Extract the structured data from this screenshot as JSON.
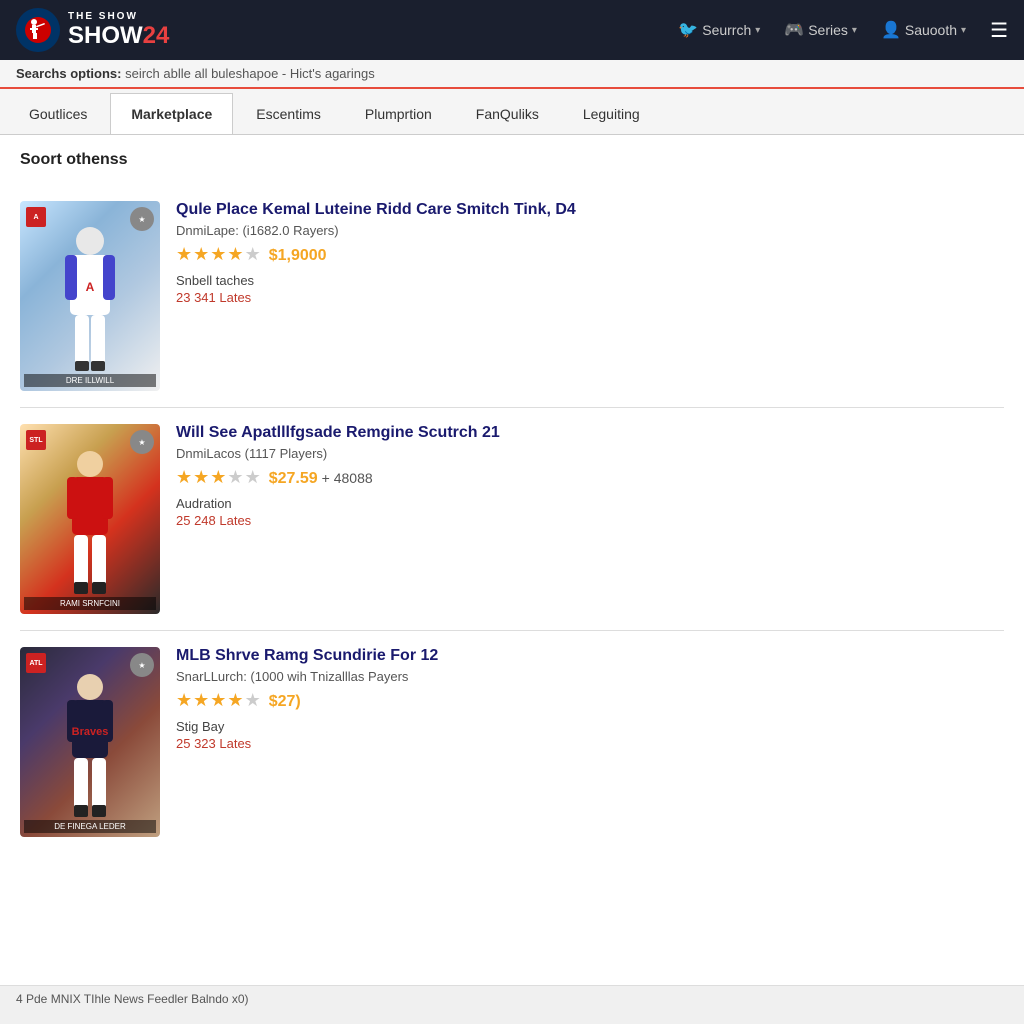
{
  "header": {
    "logo_alt": "MLB The Show 24",
    "show_text": "THE SHOW",
    "year": "24",
    "nav": [
      {
        "label": "Seurrch",
        "icon": "🐦",
        "has_chevron": true
      },
      {
        "label": "Series",
        "icon": "🎮",
        "has_chevron": true
      },
      {
        "label": "Sauooth",
        "icon": "👤",
        "has_chevron": true
      }
    ],
    "hamburger": "☰"
  },
  "search_bar": {
    "label": "Searchs options:",
    "hint": "seirch ablle all buleshapoe  -  Hict's agarings"
  },
  "tabs": [
    {
      "label": "Goutlices",
      "active": false
    },
    {
      "label": "Marketplace",
      "active": true
    },
    {
      "label": "Escentims",
      "active": false
    },
    {
      "label": "Plumprtion",
      "active": false
    },
    {
      "label": "FanQuliks",
      "active": false
    },
    {
      "label": "Leguiting",
      "active": false
    }
  ],
  "sort_header": "Soort othenss",
  "listings": [
    {
      "id": 1,
      "title": "Qule Place Kemal Luteine Ridd Care Smitch Tink, D4",
      "subtitle": "DnmiLape: (i1682.0 Rayers)",
      "stars": 4,
      "max_stars": 5,
      "price": "$1,9000",
      "type": "Snbell taches",
      "count": "23 341 Lates",
      "card_style": "card1"
    },
    {
      "id": 2,
      "title": "Will See Apatlllfgsade Remgine Scutrch 21",
      "subtitle": "DnmiLacos (1117 Players)",
      "stars": 3,
      "max_stars": 5,
      "price": "$27.59",
      "price_extra": "+ 48088",
      "type": "Audration",
      "count": "25 248 Lates",
      "card_style": "card2"
    },
    {
      "id": 3,
      "title": "MLB Shrve Ramg Scundirie For 12",
      "subtitle": "SnarLLurch: (1000 wih Tnizalllas Payers",
      "stars": 4,
      "max_stars": 5,
      "price": "$27)",
      "type": "Stig Bay",
      "count": "25 323 Lates",
      "card_style": "card3"
    }
  ],
  "footer": {
    "text": "4 Pde MNIX TIhle News Feedler Balndo x0)"
  }
}
